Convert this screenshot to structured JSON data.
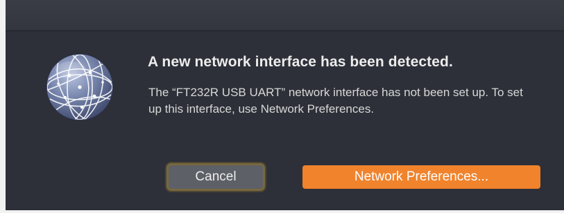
{
  "dialog": {
    "icon": "network-globe-icon",
    "title": "A new network interface has been detected.",
    "message": "The “FT232R USB UART” network interface has not been set up. To set up this interface, use Network Preferences."
  },
  "buttons": {
    "cancel_label": "Cancel",
    "primary_label": "Network Preferences..."
  },
  "colors": {
    "dialog_background": "#2d3038",
    "primary_button": "#f0832c",
    "cancel_button": "#5e6067",
    "focus_ring": "#77683e"
  }
}
